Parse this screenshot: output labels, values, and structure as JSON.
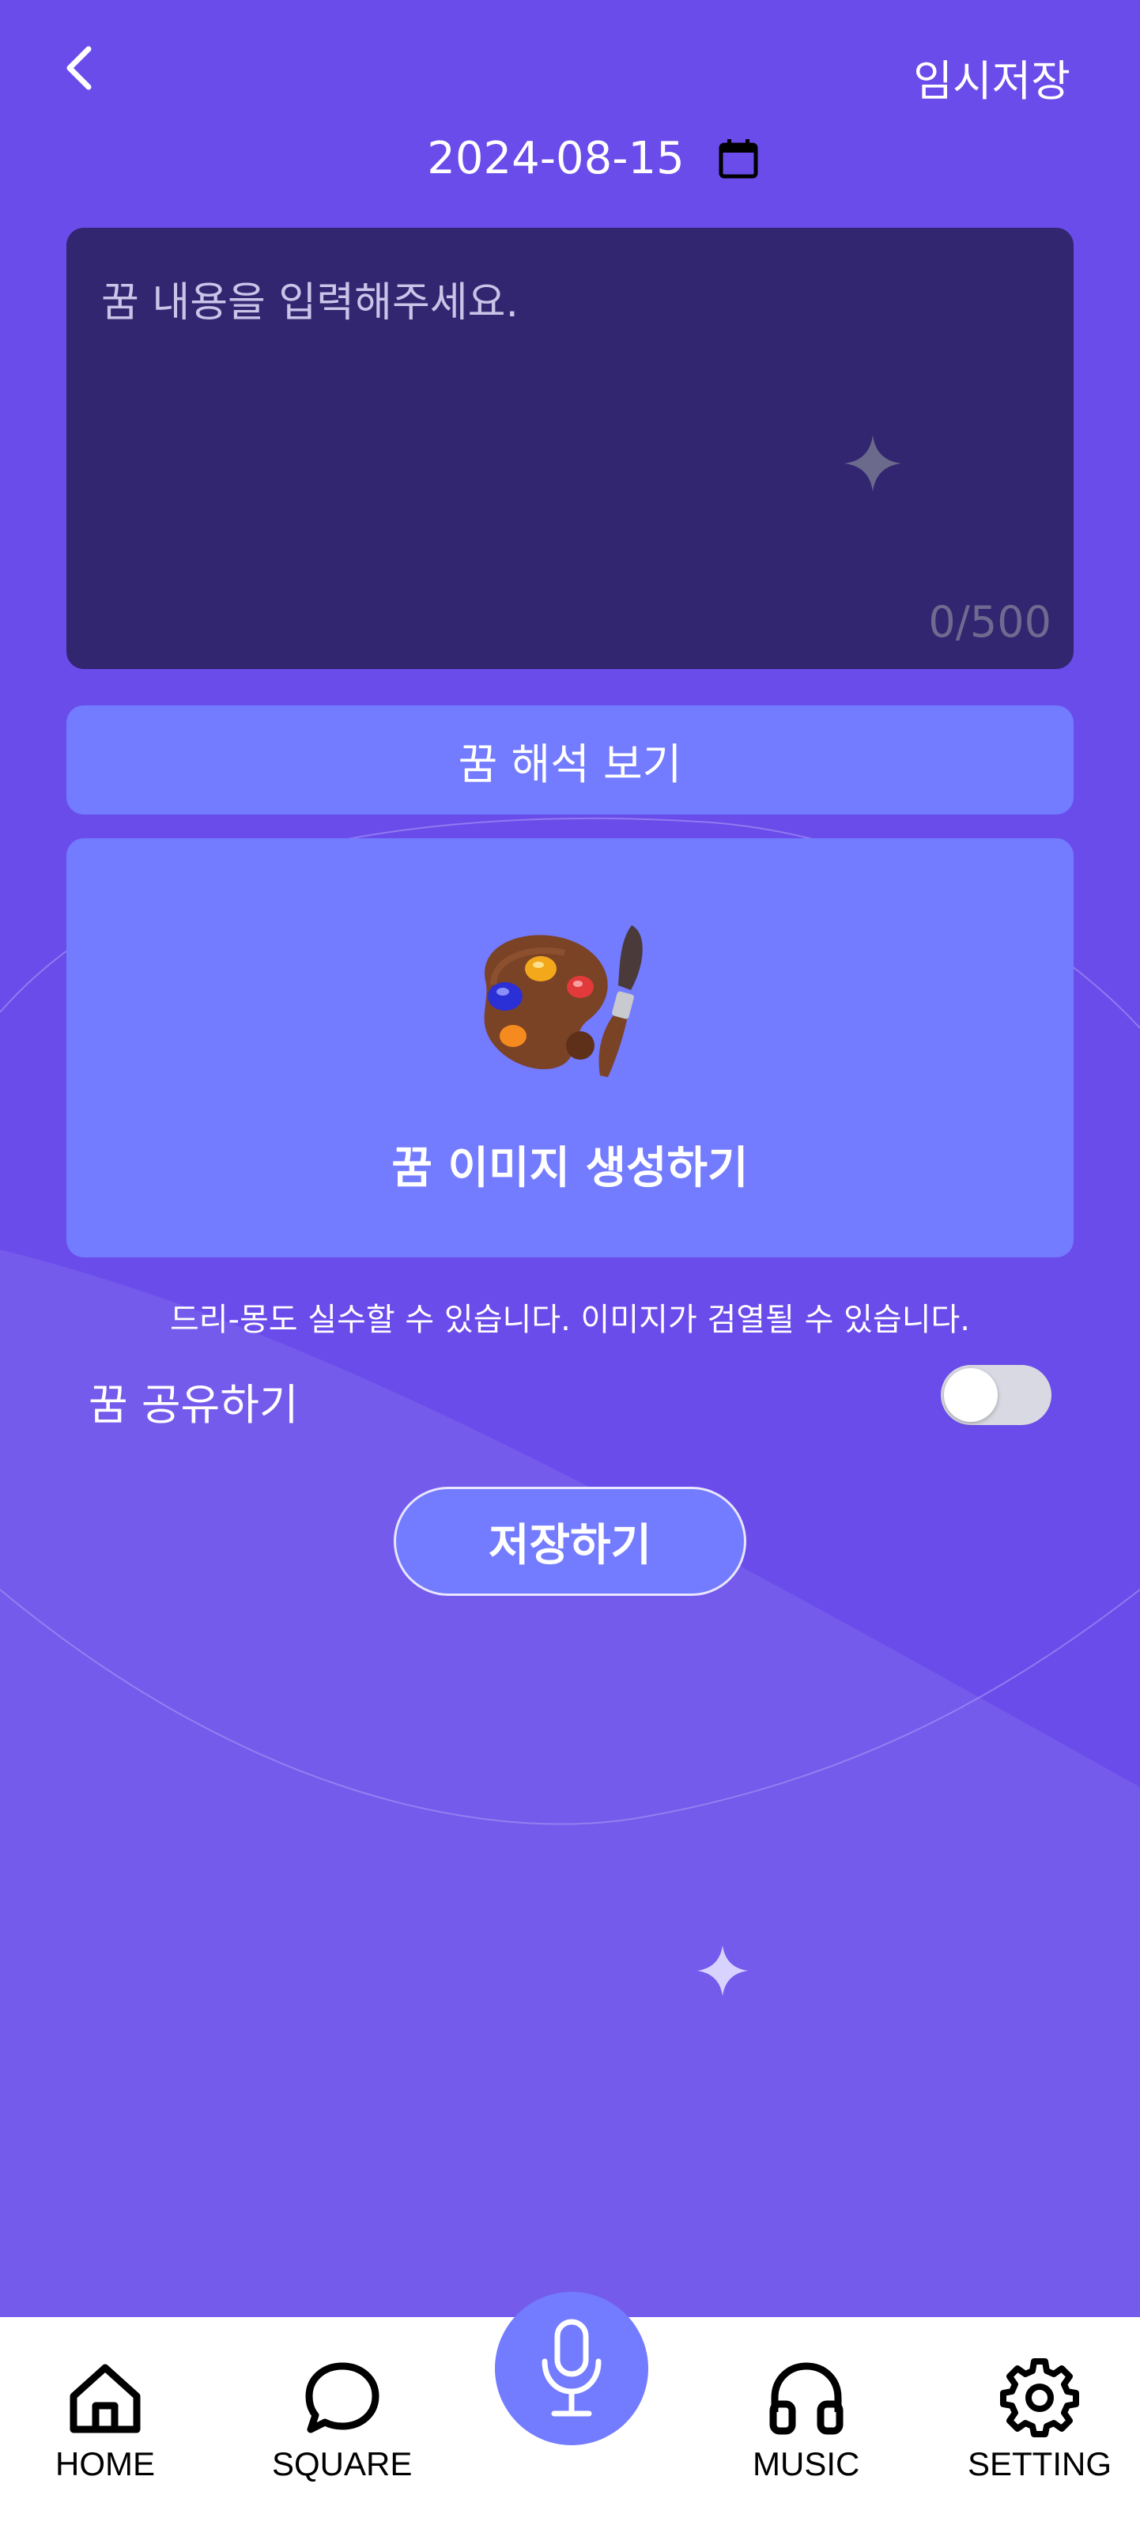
{
  "header": {
    "back_icon": "chevron-left-icon",
    "temp_save_label": "임시저장"
  },
  "date": {
    "value": "2024-08-15",
    "icon": "calendar-icon"
  },
  "dream_input": {
    "placeholder": "꿈 내용을 입력해주세요.",
    "counter": "0/500",
    "decoration_icon": "sparkle-icon"
  },
  "interpret_button": {
    "label": "꿈 해석 보기"
  },
  "image_card": {
    "icon": "palette-icon",
    "label": "꿈 이미지 생성하기"
  },
  "disclaimer": "드리-몽도 실수할 수 있습니다. 이미지가 검열될 수 있습니다.",
  "share": {
    "label": "꿈 공유하기",
    "enabled": false
  },
  "save_button": {
    "label": "저장하기"
  },
  "tabbar": {
    "items": [
      {
        "label": "HOME",
        "icon": "home-icon"
      },
      {
        "label": "SQUARE",
        "icon": "chat-bubble-icon"
      },
      {
        "label": "",
        "icon": "microphone-icon"
      },
      {
        "label": "MUSIC",
        "icon": "headphones-icon"
      },
      {
        "label": "SETTING",
        "icon": "gear-icon"
      }
    ]
  },
  "colors": {
    "background": "#6a4cea",
    "input_bg": "#31266f",
    "accent": "#737bff",
    "tabbar_bg": "#ffffff"
  }
}
